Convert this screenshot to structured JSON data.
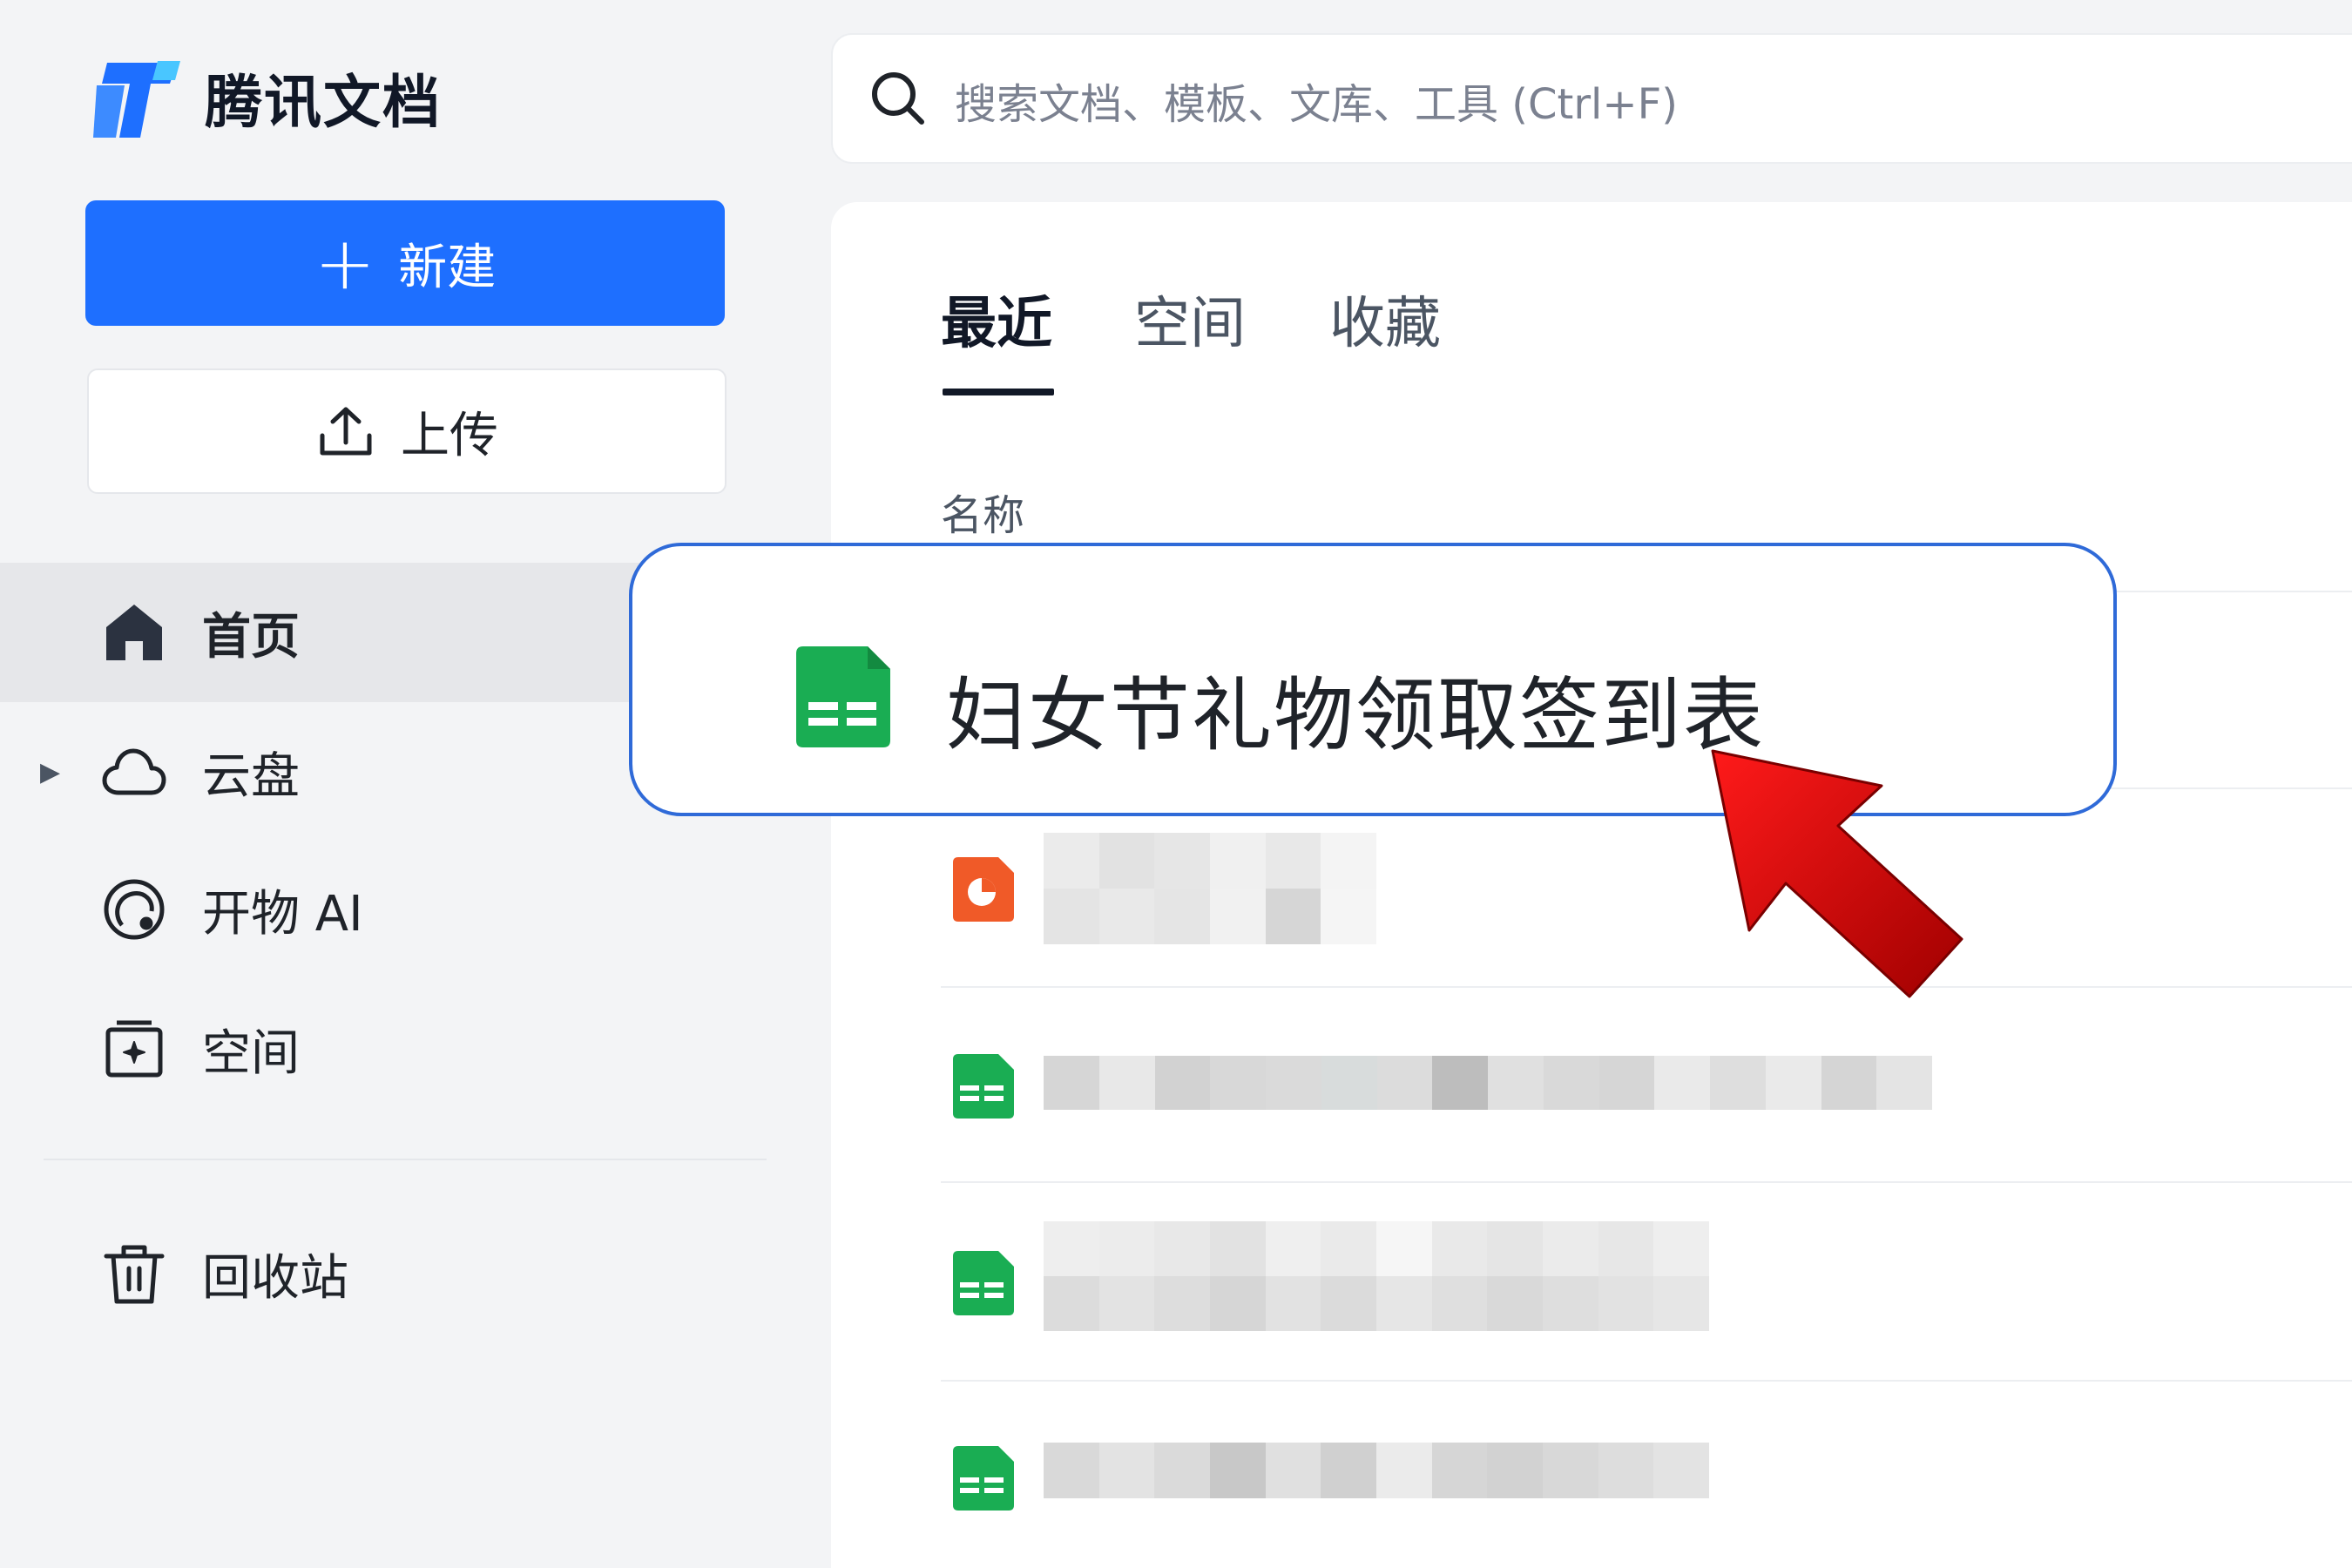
{
  "app": {
    "name": "腾讯文档"
  },
  "sidebar": {
    "new_button": "新建",
    "upload_button": "上传",
    "items": [
      {
        "label": "首页",
        "icon": "home-icon",
        "active": true
      },
      {
        "label": "云盘",
        "icon": "cloud-icon",
        "expandable": true
      },
      {
        "label": "开物 AI",
        "icon": "ai-icon"
      },
      {
        "label": "空间",
        "icon": "space-icon"
      },
      {
        "label": "回收站",
        "icon": "trash-icon"
      }
    ]
  },
  "search": {
    "placeholder": "搜索文档、模板、文库、工具 (Ctrl+F)"
  },
  "tabs": [
    {
      "label": "最近",
      "active": true
    },
    {
      "label": "空间"
    },
    {
      "label": "收藏"
    }
  ],
  "list": {
    "column_header": "名称",
    "highlighted_item": {
      "title": "妇女节礼物领取签到表",
      "type": "sheet"
    },
    "rows": [
      {
        "type": "slides"
      },
      {
        "type": "sheet"
      },
      {
        "type": "sheet"
      },
      {
        "type": "sheet"
      }
    ]
  },
  "colors": {
    "accent": "#1e6fff",
    "callout_border": "#2f6ad8",
    "arrow": "#d00000",
    "sheet_icon": "#1aad53",
    "slides_icon": "#f05a28"
  }
}
